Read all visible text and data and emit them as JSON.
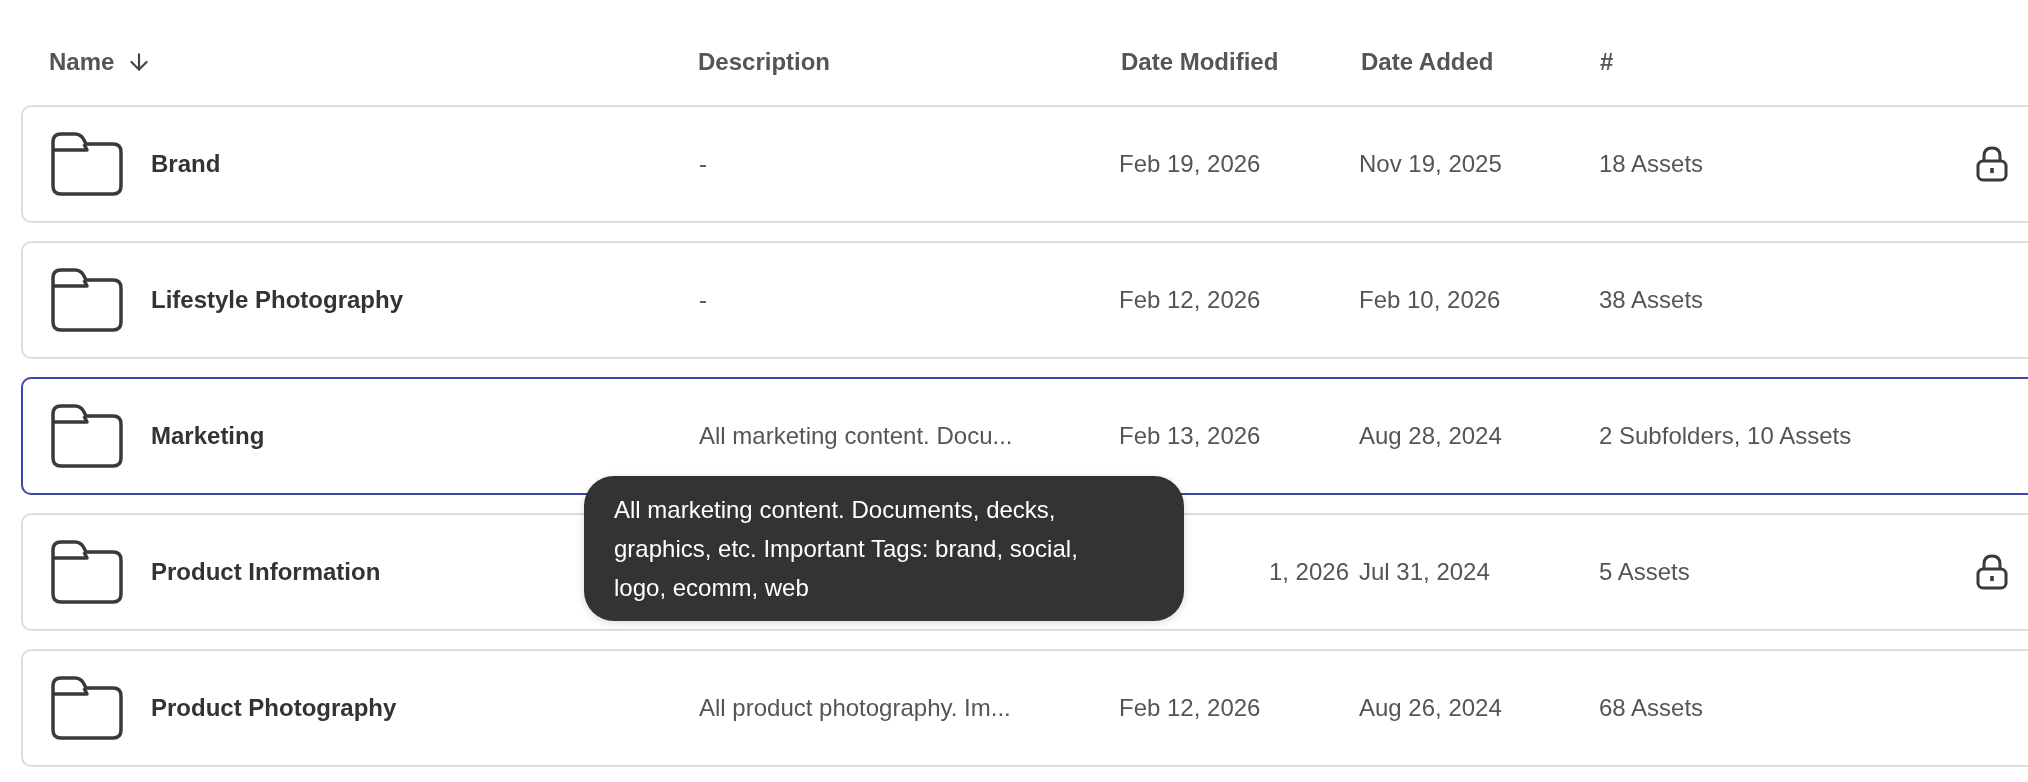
{
  "table": {
    "columns": [
      {
        "label": "Name",
        "sorted": true
      },
      {
        "label": "Description",
        "sorted": false
      },
      {
        "label": "Date Modified",
        "sorted": false
      },
      {
        "label": "Date Added",
        "sorted": false
      },
      {
        "label": "#",
        "sorted": false
      }
    ],
    "rows": [
      {
        "name": "Brand",
        "description": "-",
        "date_modified": "Feb 19, 2026",
        "date_added": "Nov 19, 2025",
        "count": "18 Assets",
        "locked": true,
        "selected": false
      },
      {
        "name": "Lifestyle Photography",
        "description": "-",
        "date_modified": "Feb 12, 2026",
        "date_added": "Feb 10, 2026",
        "count": "38 Assets",
        "locked": false,
        "selected": false
      },
      {
        "name": "Marketing",
        "description": "All marketing content. Docu...",
        "date_modified": "Feb 13, 2026",
        "date_added": "Aug 28, 2024",
        "count": "2 Subfolders, 10 Assets",
        "locked": false,
        "selected": true,
        "tooltip": "All marketing content. Documents, decks, graphics, etc. Important Tags: brand, social, logo, ecomm, web"
      },
      {
        "name": "Product Information",
        "date_modified": "1, 2026",
        "date_added": "Jul 31, 2024",
        "count": "5 Assets",
        "locked": true,
        "selected": false,
        "covered": true
      },
      {
        "name": "Product Photography",
        "description": "All product photography. Im...",
        "date_modified": "Feb 12, 2026",
        "date_added": "Aug 26, 2024",
        "count": "68 Assets",
        "locked": false,
        "selected": false
      }
    ]
  }
}
